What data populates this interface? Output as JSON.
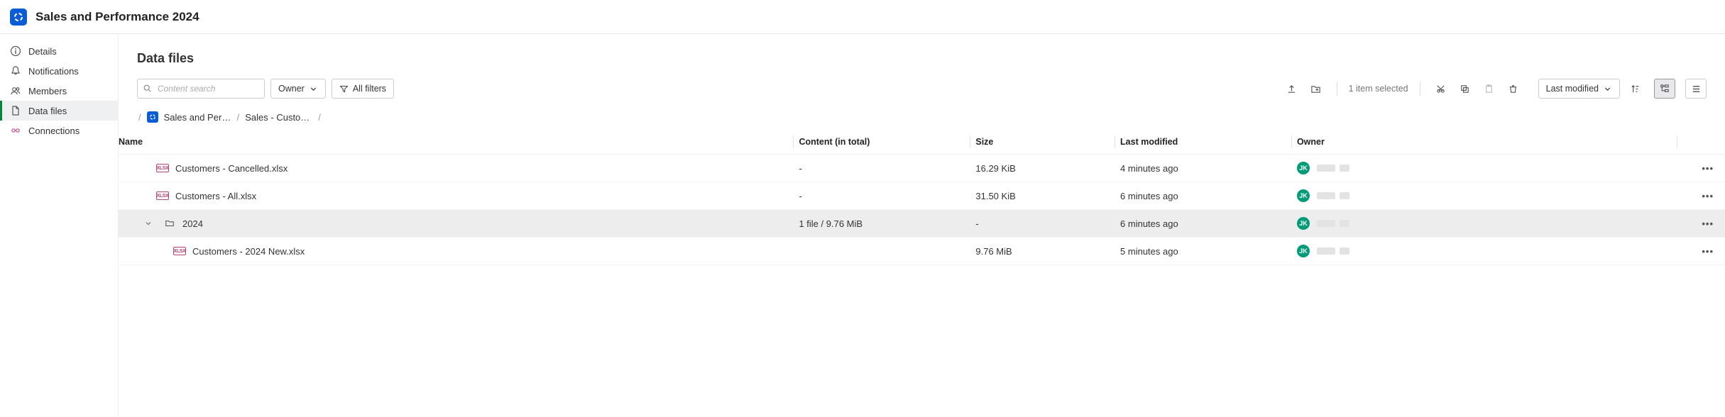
{
  "header": {
    "title": "Sales and Performance 2024"
  },
  "sidebar": {
    "items": [
      {
        "id": "details",
        "label": "Details",
        "icon": "info"
      },
      {
        "id": "notifications",
        "label": "Notifications",
        "icon": "bell"
      },
      {
        "id": "members",
        "label": "Members",
        "icon": "users"
      },
      {
        "id": "data-files",
        "label": "Data files",
        "icon": "file",
        "active": true
      },
      {
        "id": "connections",
        "label": "Connections",
        "icon": "link"
      }
    ]
  },
  "main": {
    "section_title": "Data files",
    "search": {
      "placeholder": "Content search"
    },
    "filters": {
      "owner_label": "Owner",
      "all_filters_label": "All filters"
    },
    "selection_text": "1 item selected",
    "sort": {
      "label": "Last modified"
    },
    "breadcrumb": {
      "root": "Sales and Perf…",
      "current": "Sales - Custom…"
    },
    "columns": {
      "name": "Name",
      "content": "Content (in total)",
      "size": "Size",
      "modified": "Last modified",
      "owner": "Owner"
    },
    "rows": [
      {
        "type": "file",
        "name": "Customers - Cancelled.xlsx",
        "content": "-",
        "size": "16.29 KiB",
        "modified": "4 minutes ago",
        "owner_initials": "JK",
        "indent": 0
      },
      {
        "type": "file",
        "name": "Customers - All.xlsx",
        "content": "-",
        "size": "31.50 KiB",
        "modified": "6 minutes ago",
        "owner_initials": "JK",
        "indent": 0
      },
      {
        "type": "folder",
        "name": "2024",
        "content": "1 file / 9.76 MiB",
        "size": "-",
        "modified": "6 minutes ago",
        "owner_initials": "JK",
        "indent": 0,
        "expanded": true,
        "selected": true
      },
      {
        "type": "file",
        "name": "Customers - 2024 New.xlsx",
        "content": "",
        "size": "9.76 MiB",
        "modified": "5 minutes ago",
        "owner_initials": "JK",
        "indent": 1
      }
    ]
  }
}
